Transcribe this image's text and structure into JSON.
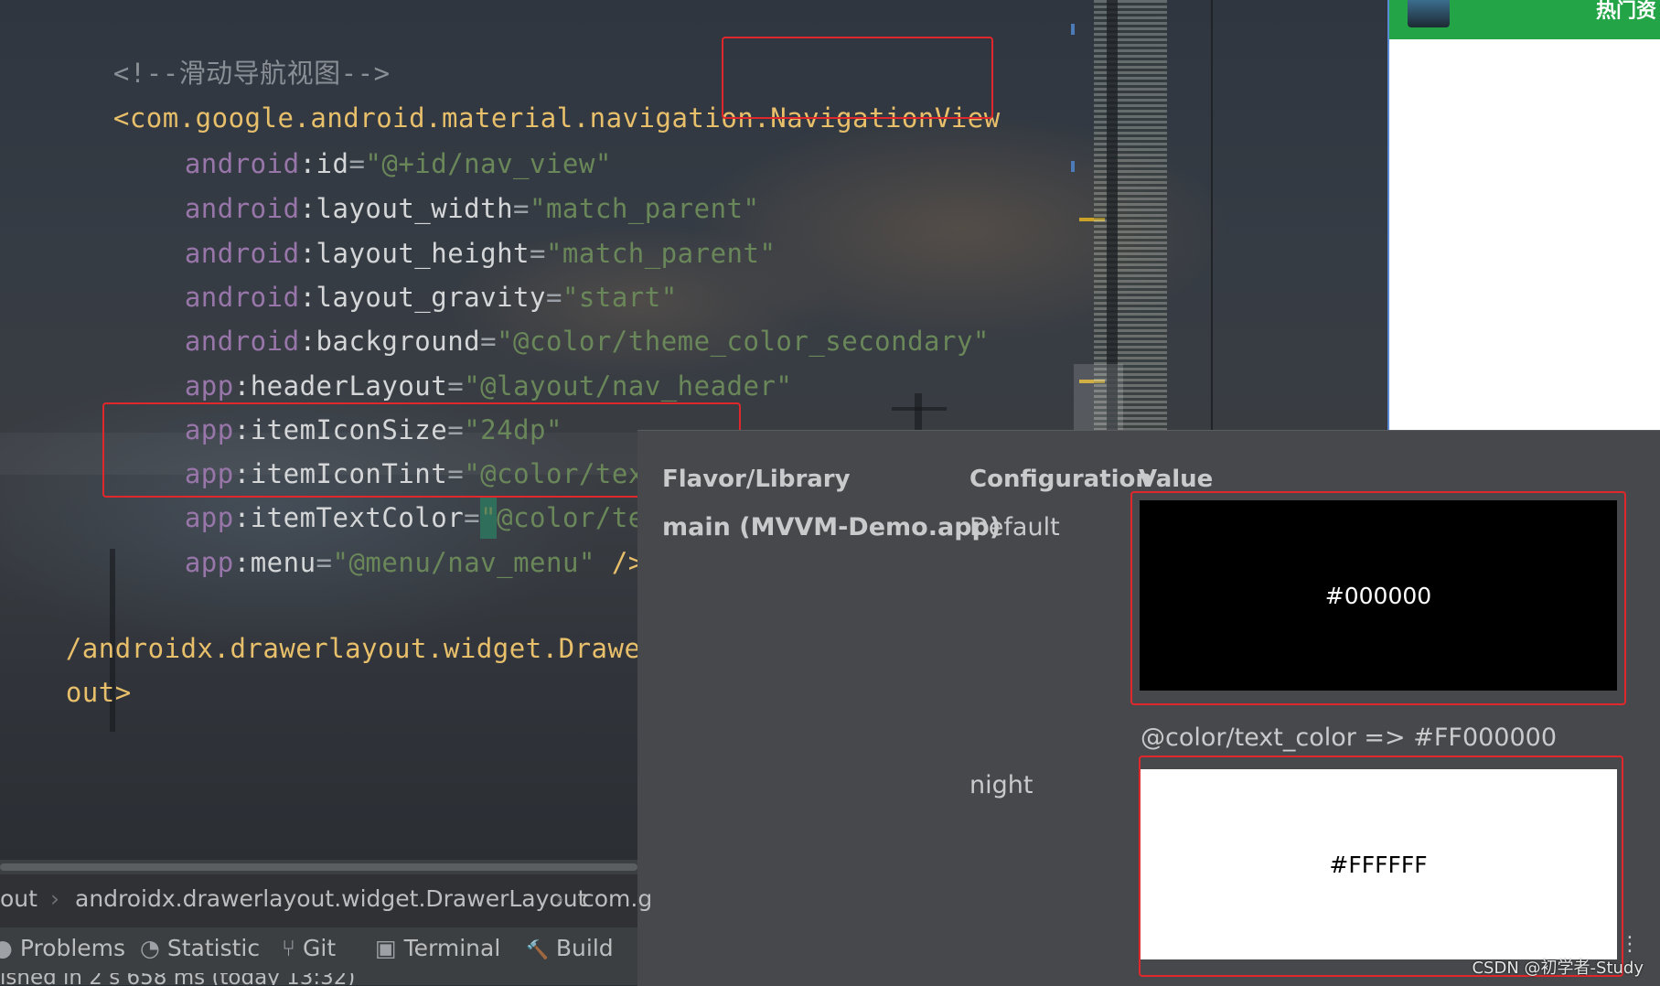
{
  "editor": {
    "lines": {
      "l1_comment": "<!--滑动导航视图-->",
      "l2_open": "<",
      "l2_tag": "com.google.android.material.navigation.NavigationView",
      "l3_ns": "android",
      "l3_attr": ":id",
      "l3_eq": "=",
      "l3_val": "\"@+id/nav_view\"",
      "l4_ns": "android",
      "l4_attr": ":layout_width",
      "l4_eq": "=",
      "l4_val": "\"match_parent\"",
      "l5_ns": "android",
      "l5_attr": ":layout_height",
      "l5_eq": "=",
      "l5_val": "\"match_parent\"",
      "l6_ns": "android",
      "l6_attr": ":layout_gravity",
      "l6_eq": "=",
      "l6_val": "\"start\"",
      "l7_ns": "android",
      "l7_attr": ":background",
      "l7_eq": "=",
      "l7_val": "\"@color/theme_color_secondary\"",
      "l8_ns": "app",
      "l8_attr": ":headerLayout",
      "l8_eq": "=",
      "l8_val": "\"@layout/nav_header\"",
      "l9_ns": "app",
      "l9_attr": ":itemIconSize",
      "l9_eq": "=",
      "l9_val": "\"24dp\"",
      "l10_ns": "app",
      "l10_attr": ":itemIconTint",
      "l10_eq": "=",
      "l10_val": "\"@color/text_color\"",
      "l11_ns": "app",
      "l11_attr": ":itemTextColor",
      "l11_eq": "=",
      "l11_q": "\"",
      "l11_val": "@color/text_c",
      "l12_ns": "app",
      "l12_attr": ":menu",
      "l12_eq": "=",
      "l12_val": "\"@menu/nav_menu\"",
      "l12_end": " />",
      "l13_close": "/androidx.drawerlayout.widget.DrawerLay",
      "l14_close": "out>"
    }
  },
  "preview": {
    "title": "热门资"
  },
  "popup": {
    "headers": {
      "flavor": "Flavor/Library",
      "configuration": "Configuration",
      "value": "Value"
    },
    "row_library": "main (MVVM-Demo.app)",
    "rows": [
      {
        "config": "Default",
        "swatch_hex": "#000000",
        "swatch_color": "#000000",
        "swatch_text_color": "#ffffff"
      },
      {
        "config": "night",
        "swatch_hex": "#FFFFFF",
        "swatch_color": "#ffffff",
        "swatch_text_color": "#000000"
      }
    ],
    "resolved": "@color/text_color => #FF000000",
    "more_icon": "⋮"
  },
  "breadcrumb": {
    "items": [
      "out",
      "androidx.drawerlayout.widget.DrawerLayout",
      "com.g"
    ],
    "separator": "›"
  },
  "toolbar": {
    "items": [
      {
        "label": "Problems",
        "icon": "problems-icon",
        "glyph": "●"
      },
      {
        "label": "Statistic",
        "icon": "statistic-icon",
        "glyph": "◔"
      },
      {
        "label": "Git",
        "icon": "git-icon",
        "glyph": "⑂"
      },
      {
        "label": "Terminal",
        "icon": "terminal-icon",
        "glyph": "▣"
      },
      {
        "label": "Build",
        "icon": "build-icon",
        "glyph": "🔨"
      }
    ]
  },
  "status": {
    "text": "ished in 2 s 658 ms (today 13:32)"
  },
  "watermark": "CSDN @初学者-Study",
  "colors": {
    "tag": "#e8bf6a",
    "namespace": "#9876aa",
    "string": "#6a8759",
    "highlight_box": "#e0272b",
    "preview_header": "#22a447"
  }
}
